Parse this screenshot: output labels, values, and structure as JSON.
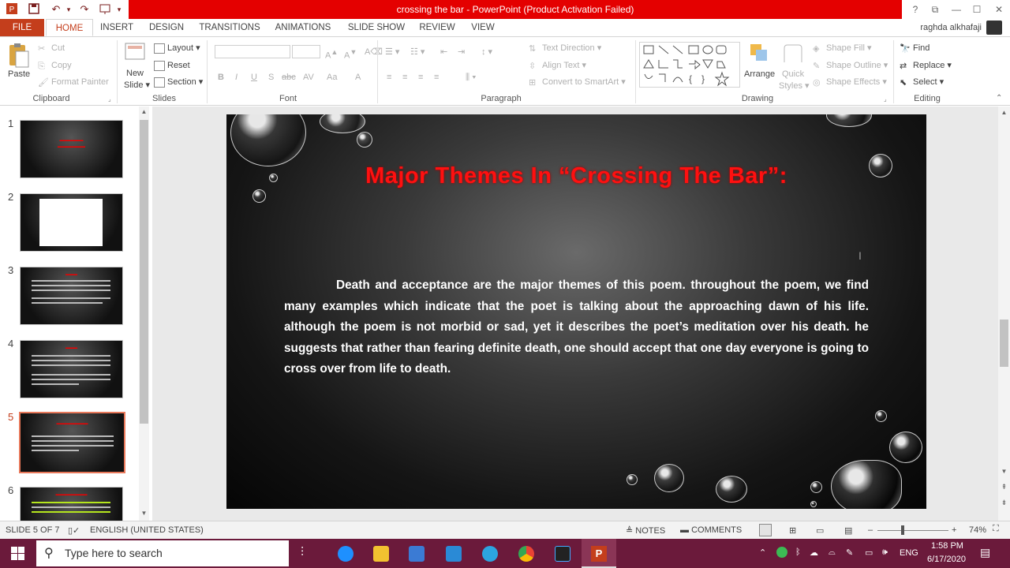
{
  "window": {
    "title": "crossing the bar -  PowerPoint (Product Activation Failed)",
    "help": "?",
    "restore": "⧉",
    "minimize": "—",
    "maximize": "☐",
    "close": "✕"
  },
  "quick_access": {
    "save": "save-icon",
    "undo": "↶",
    "redo": "↷"
  },
  "tabs": [
    "FILE",
    "HOME",
    "INSERT",
    "DESIGN",
    "TRANSITIONS",
    "ANIMATIONS",
    "SLIDE SHOW",
    "REVIEW",
    "VIEW"
  ],
  "active_tab": "HOME",
  "user": "raghda alkhafaji",
  "ribbon": {
    "clipboard": {
      "paste": "Paste",
      "cut": "Cut",
      "copy": "Copy",
      "format_painter": "Format Painter",
      "label": "Clipboard"
    },
    "slides": {
      "new_slide_1": "New",
      "new_slide_2": "Slide",
      "layout": "Layout",
      "reset": "Reset",
      "section": "Section",
      "label": "Slides"
    },
    "font": {
      "bold": "B",
      "italic": "I",
      "underline": "U",
      "shadow": "S",
      "strike": "abc",
      "spacing": "AV",
      "case": "Aa",
      "color": "A",
      "label": "Font"
    },
    "paragraph": {
      "text_direction": "Text Direction",
      "align_text": "Align Text",
      "convert_smartart": "Convert to SmartArt",
      "label": "Paragraph"
    },
    "drawing": {
      "arrange": "Arrange",
      "quick_styles_1": "Quick",
      "quick_styles_2": "Styles",
      "shape_fill": "Shape Fill",
      "shape_outline": "Shape Outline",
      "shape_effects": "Shape Effects",
      "label": "Drawing"
    },
    "editing": {
      "find": "Find",
      "replace": "Replace",
      "select": "Select",
      "label": "Editing"
    }
  },
  "thumbnails": [
    {
      "num": "1",
      "selected": false
    },
    {
      "num": "2",
      "selected": false
    },
    {
      "num": "3",
      "selected": false
    },
    {
      "num": "4",
      "selected": false
    },
    {
      "num": "5",
      "selected": true
    },
    {
      "num": "6",
      "selected": false
    }
  ],
  "slide": {
    "title": "Major Themes In “Crossing The Bar”:",
    "body": "Death and acceptance are the major themes of this poem. throughout the poem, we find many examples which indicate that the poet is talking about the approaching dawn of his life. although the poem is not morbid or sad, yet it describes the poet’s meditation over his death. he suggests that rather than fearing definite death, one should accept that one day everyone is going to cross over from life to death."
  },
  "status": {
    "slide_of": "SLIDE 5 OF 7",
    "language": "ENGLISH (UNITED STATES)",
    "notes": "NOTES",
    "comments": "COMMENTS",
    "zoom": "74%",
    "zoom_minus": "–",
    "zoom_plus": "+"
  },
  "taskbar": {
    "search_placeholder": "Type here to search",
    "lang": "ENG",
    "time": "1:58 PM",
    "date": "6/17/2020"
  },
  "colors": {
    "title_bar": "#e40000",
    "accent": "#c43e1c",
    "taskbar": "#6b1a3b",
    "slide_title": "#ff1010"
  }
}
